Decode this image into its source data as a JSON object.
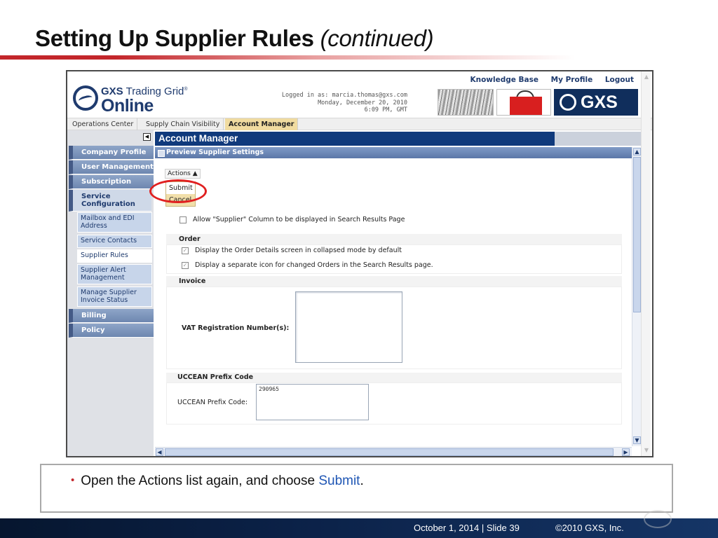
{
  "slide": {
    "title": "Setting Up Supplier Rules",
    "title_sub": "(continued)",
    "bullet_prefix": "Open the Actions list again, and choose ",
    "bullet_highlight": "Submit",
    "bullet_suffix": ".",
    "footer_date_slide": "October 1, 2014  |  Slide 39",
    "footer_copyright": "©2010 GXS, Inc."
  },
  "app": {
    "logo_top_bold": "GXS",
    "logo_top_rest": " Trading Grid",
    "logo_registered": "®",
    "logo_bottom": "Online",
    "login_line1": "Logged in as: marcia.thomas@gxs.com",
    "login_line2": "Monday, December 20, 2010",
    "login_line3": "6:09 PM, GMT",
    "banner_brand": "GXS",
    "top_links": [
      "Knowledge Base",
      "My Profile",
      "Logout"
    ],
    "tabs": [
      "Operations Center",
      "Supply Chain Visibility",
      "Account Manager"
    ],
    "active_tab": "Account Manager",
    "collapse_symbol": "◀"
  },
  "sidebar": {
    "groups": [
      "Company Profile",
      "User Management",
      "Subscription",
      "Service Configuration",
      "Billing",
      "Policy"
    ],
    "service_items": [
      "Mailbox and EDI Address",
      "Service Contacts",
      "Supplier Rules",
      "Supplier Alert Management",
      "Manage Supplier Invoice Status"
    ],
    "active_item": "Supplier Rules"
  },
  "main": {
    "header": "Account Manager",
    "panel_title": "Preview Supplier Settings",
    "actions_label": "Actions ▲",
    "actions_menu": [
      "Submit",
      "Cancel"
    ],
    "allow_supplier_column": "Allow \"Supplier\" Column to be displayed in Search Results Page",
    "allow_supplier_checked": false,
    "order_heading": "Order",
    "order_opt1": "Display the Order Details screen in collapsed mode by default",
    "order_opt2": "Display a separate icon for changed Orders in the Search Results page.",
    "invoice_heading": "Invoice",
    "vat_label": "VAT Registration Number(s):",
    "vat_value": "",
    "uccean_heading": "UCCEAN Prefix Code",
    "uccean_label": "UCCEAN Prefix Code:",
    "uccean_value": "290965"
  },
  "colors": {
    "title_rule": "#c3262b",
    "brand_navy": "#1f3b6e",
    "tab_active": "#f0dba0",
    "highlight_circle": "#e02020",
    "link_blue": "#1f56b4"
  }
}
